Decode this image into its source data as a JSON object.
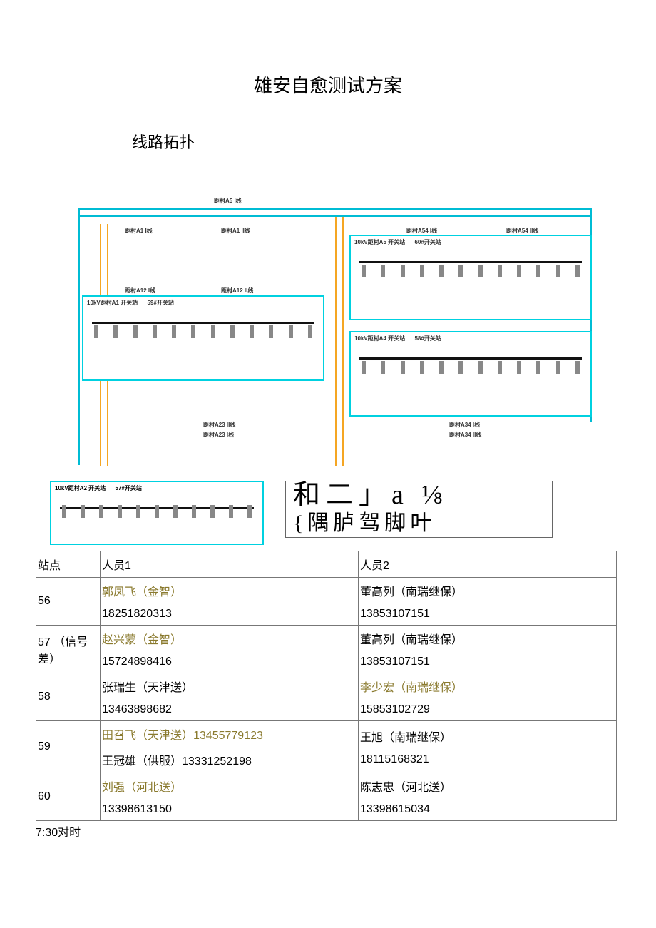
{
  "title": "雄安自愈测试方案",
  "section_topology": "线路拓扑",
  "diagram_labels": {
    "top_center": "距村A5 I线",
    "top_left1": "距村A1 I线",
    "top_left2": "距村A1 II线",
    "mid_left1": "距村A12 I线",
    "mid_left2": "距村A12 II线",
    "right1": "距村A54 I线",
    "right2": "距村A54 II线",
    "bot1": "距村A23 II线",
    "bot2": "距村A23 I线",
    "bot_r1": "距村A34 I线",
    "bot_r2": "距村A34 II线",
    "station_a5": "10kV距村A5 开关站",
    "station_a5_r": "60#开关站",
    "station_a1": "10kV距村A1 开关站",
    "station_a1_r": "59#开关站",
    "station_a4": "10kV距村A4 开关站",
    "station_a4_r": "58#开关站",
    "station_a2": "10kV距村A2 开关站",
    "station_a2_r": "57#开关站"
  },
  "placeholder": {
    "line1": "和二」a ⅛",
    "line2": "{隅胪驾脚叶"
  },
  "table": {
    "headers": {
      "site": "站点",
      "p1": "人员1",
      "p2": "人员2"
    },
    "rows": [
      {
        "site": "56",
        "p1_name": "郭凤飞（金智）",
        "p1_phone": "18251820313",
        "p2_name": "董高列（南瑞继保）",
        "p2_phone": "13853107151",
        "p1_hl": true,
        "p2_hl": false
      },
      {
        "site": "57 （信号差）",
        "p1_name": "赵兴蒙（金智）",
        "p1_phone": "15724898416",
        "p2_name": "董高列（南瑞继保）",
        "p2_phone": "13853107151",
        "p1_hl": true,
        "p2_hl": false
      },
      {
        "site": "58",
        "p1_name": "张瑞生（天津送）",
        "p1_phone": "13463898682",
        "p2_name": "李少宏（南瑞继保）",
        "p2_phone": "15853102729",
        "p1_hl": false,
        "p2_hl": true
      },
      {
        "site": "59",
        "p1_line1": "田召飞（天津送）13455779123",
        "p1_line2": "王冠雄（供服）13331252198",
        "p2_name": "王旭（南瑞继保）",
        "p2_phone": "18115168321",
        "p1_hl": true,
        "p2_hl": false,
        "multi": true
      },
      {
        "site": "60",
        "p1_name": "刘强（河北送）",
        "p1_phone": "13398613150",
        "p2_name": "陈志忠（河北送）",
        "p2_phone": "13398615034",
        "p1_hl": true,
        "p2_hl": false
      }
    ]
  },
  "footnote": "7:30对时"
}
